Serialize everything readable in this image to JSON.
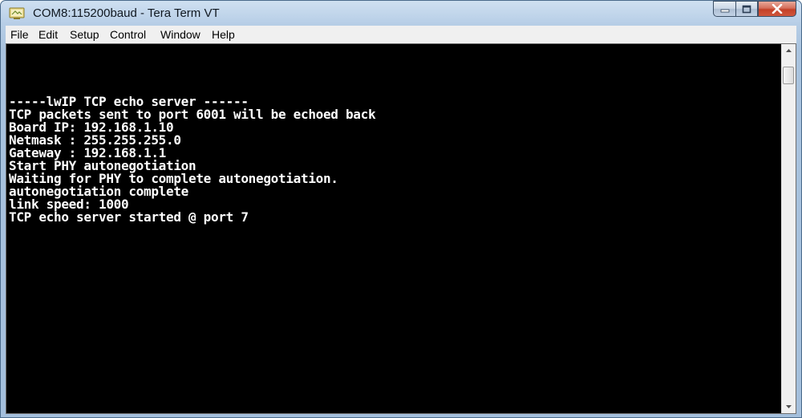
{
  "window": {
    "title": "COM8:115200baud - Tera Term VT"
  },
  "menu": {
    "items": [
      {
        "label": "File"
      },
      {
        "label": "Edit"
      },
      {
        "label": "Setup"
      },
      {
        "label": "Control"
      },
      {
        "label": "Window"
      },
      {
        "label": "Help"
      }
    ]
  },
  "terminal": {
    "lines": [
      "-----lwIP TCP echo server ------",
      "TCP packets sent to port 6001 will be echoed back",
      "Board IP: 192.168.1.10",
      "Netmask : 255.255.255.0",
      "Gateway : 192.168.1.1",
      "Start PHY autonegotiation",
      "Waiting for PHY to complete autonegotiation.",
      "autonegotiation complete",
      "link speed: 1000",
      "TCP echo server started @ port 7"
    ]
  },
  "icons": {
    "app": "tera-term-icon",
    "minimize": "minimize-icon",
    "maximize": "maximize-icon",
    "close": "close-icon",
    "scroll_up": "arrow-up-icon",
    "scroll_down": "arrow-down-icon"
  },
  "colors": {
    "terminal_background": "#000000",
    "terminal_text": "#ffffff",
    "close_button": "#c44128"
  }
}
